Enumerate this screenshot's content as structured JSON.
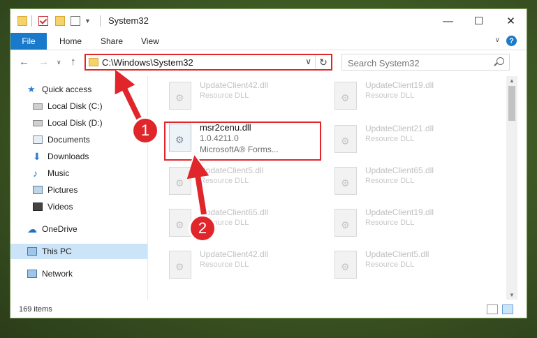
{
  "window": {
    "title": "System32"
  },
  "ribbon": {
    "tabs": [
      "File",
      "Home",
      "Share",
      "View"
    ],
    "help": "?"
  },
  "address": {
    "path": "C:\\Windows\\System32"
  },
  "search": {
    "placeholder": "Search System32"
  },
  "sidebar": {
    "items": [
      {
        "label": "Quick access",
        "icon": "star-icon",
        "pinned": false
      },
      {
        "label": "Local Disk (C:)",
        "icon": "drive-icon",
        "pinned": true
      },
      {
        "label": "Local Disk (D:)",
        "icon": "drive-icon",
        "pinned": false
      },
      {
        "label": "Documents",
        "icon": "documents-icon",
        "pinned": true
      },
      {
        "label": "Downloads",
        "icon": "download-icon",
        "pinned": true
      },
      {
        "label": "Music",
        "icon": "music-icon",
        "pinned": true
      },
      {
        "label": "Pictures",
        "icon": "pictures-icon",
        "pinned": true
      },
      {
        "label": "Videos",
        "icon": "videos-icon",
        "pinned": true
      },
      {
        "label": "OneDrive",
        "icon": "cloud-icon",
        "pinned": false
      },
      {
        "label": "This PC",
        "icon": "computer-icon",
        "pinned": false,
        "selected": true
      },
      {
        "label": "Network",
        "icon": "network-icon",
        "pinned": false
      }
    ]
  },
  "files": {
    "left": [
      {
        "name": "UpdateClient42.dll",
        "desc": "Resource DLL"
      },
      {
        "name": "msr2cenu.dll",
        "desc": "1.0.4211.0",
        "desc2": "MicrosoftA® Forms...",
        "highlight": true
      },
      {
        "name": "UpdateClient5.dll",
        "desc": "Resource DLL"
      },
      {
        "name": "UpdateClient65.dll",
        "desc": "Resource DLL"
      },
      {
        "name": "UpdateClient42.dll",
        "desc": "Resource DLL"
      }
    ],
    "right": [
      {
        "name": "UpdateClient19.dll",
        "desc": "Resource DLL"
      },
      {
        "name": "UpdateClient21.dll",
        "desc": "Resource DLL"
      },
      {
        "name": "UpdateClient65.dll",
        "desc": "Resource DLL"
      },
      {
        "name": "UpdateClient19.dll",
        "desc": "Resource DLL"
      },
      {
        "name": "UpdateClient5.dll",
        "desc": "Resource DLL"
      }
    ]
  },
  "status": {
    "count": "169 items"
  },
  "annotations": {
    "step1": "1",
    "step2": "2",
    "color": "#e0252b"
  }
}
